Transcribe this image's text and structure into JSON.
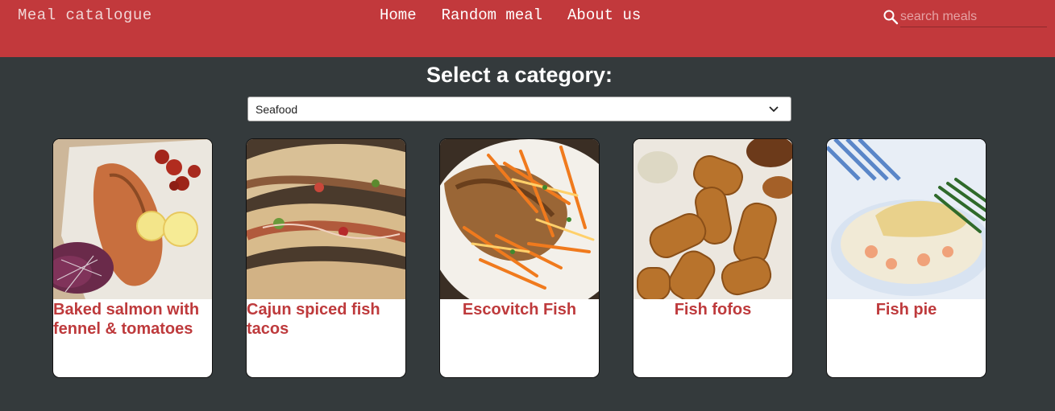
{
  "header": {
    "brand": "Meal catalogue",
    "nav": [
      "Home",
      "Random meal",
      "About us"
    ],
    "search_placeholder": "search meals"
  },
  "category": {
    "title": "Select a category:",
    "selected": "Seafood"
  },
  "meals": [
    {
      "name": "Baked salmon with fennel & tomatoes"
    },
    {
      "name": "Cajun spiced fish tacos"
    },
    {
      "name": "Escovitch Fish"
    },
    {
      "name": "Fish fofos"
    },
    {
      "name": "Fish pie"
    }
  ],
  "colors": {
    "header_bg": "#c2393c",
    "page_bg": "#343a3c",
    "accent_text": "#be3a3c"
  }
}
